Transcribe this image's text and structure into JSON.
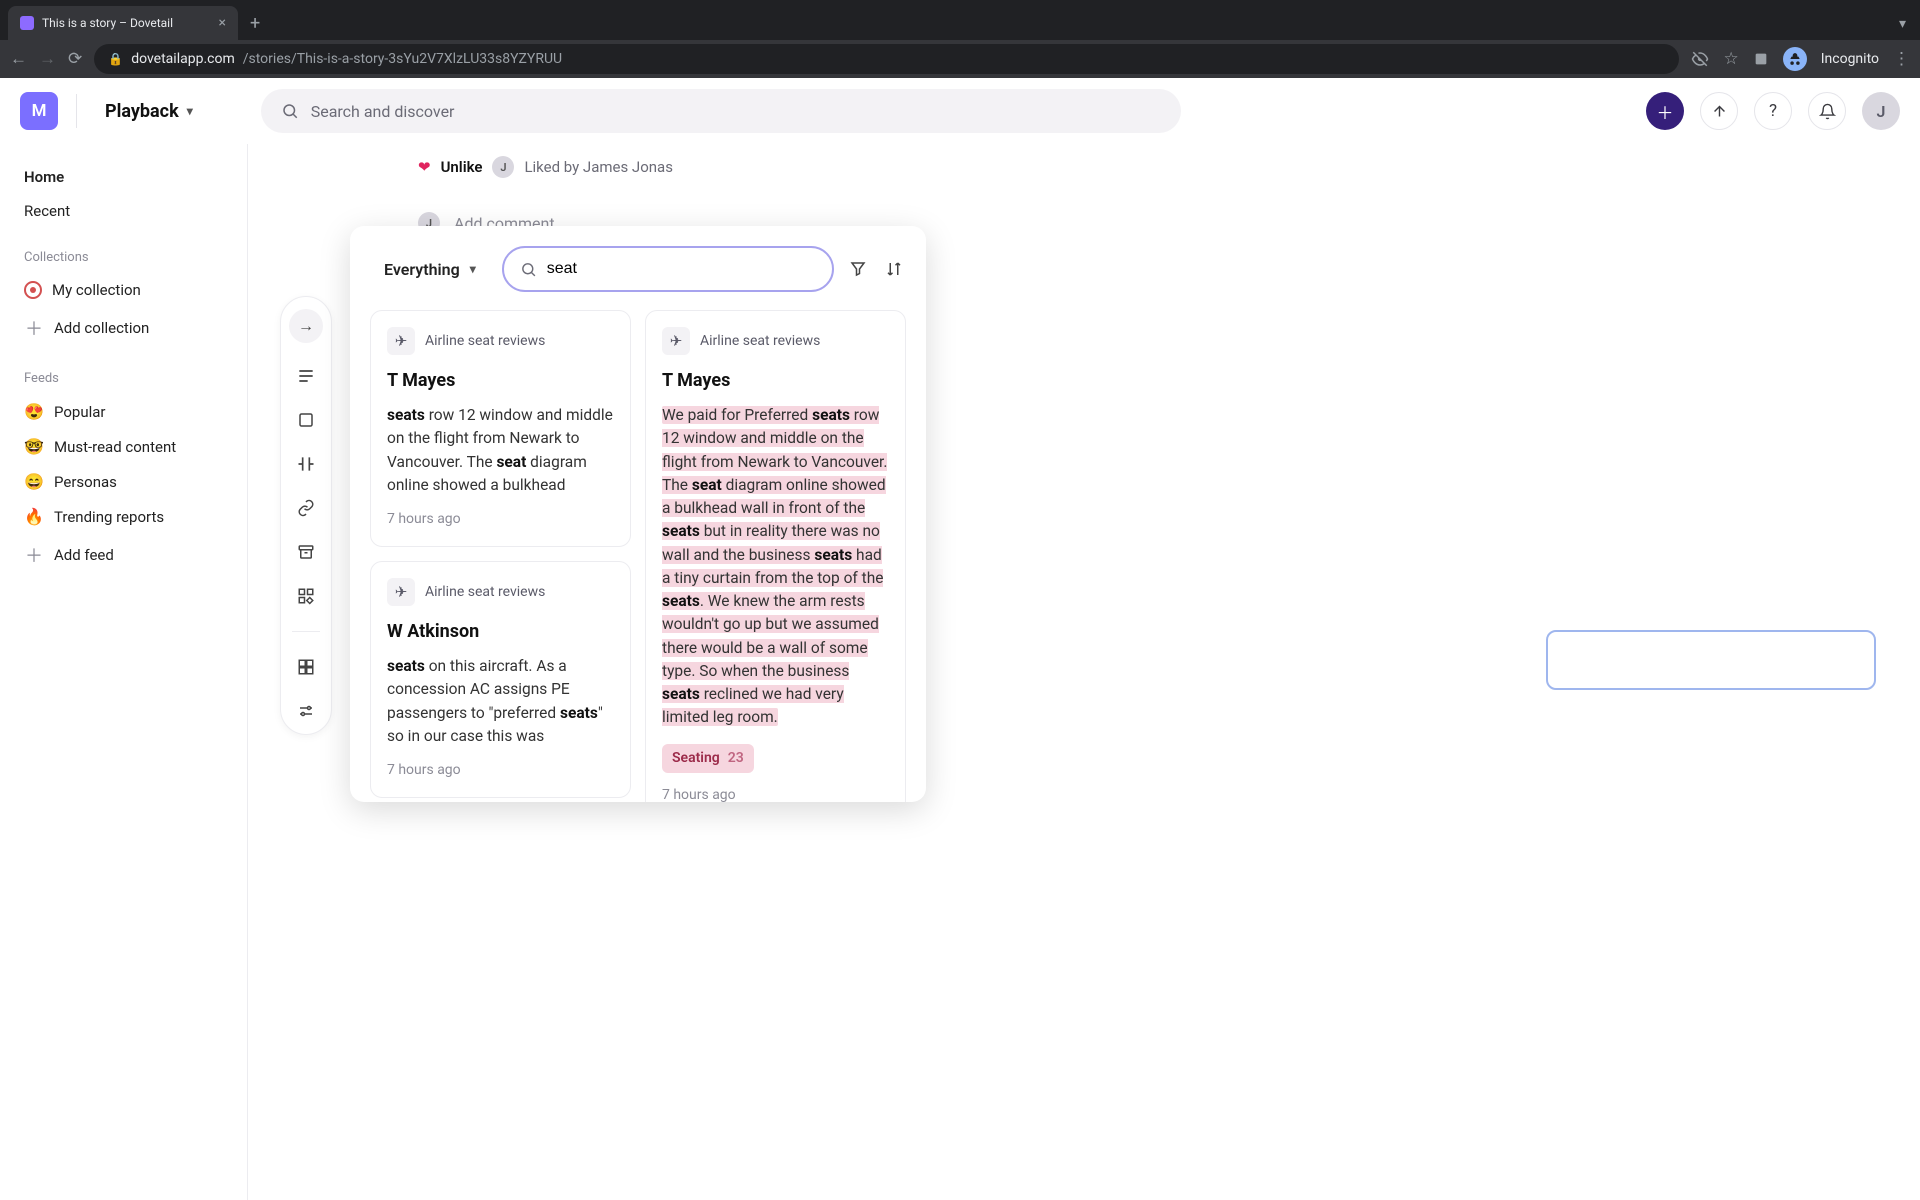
{
  "browser": {
    "tab_title": "This is a story – Dovetail",
    "url_host": "dovetailapp.com",
    "url_path": "/stories/This-is-a-story-3sYu2V7XlzLU33s8YZYRUU",
    "incognito_label": "Incognito"
  },
  "header": {
    "workspace_initial": "M",
    "product_name": "Playback",
    "global_search_placeholder": "Search and discover",
    "user_initial": "J"
  },
  "sidebar": {
    "home": "Home",
    "recent": "Recent",
    "collections_label": "Collections",
    "my_collection": "My collection",
    "add_collection": "Add collection",
    "feeds_label": "Feeds",
    "feeds": [
      {
        "emoji": "😍",
        "label": "Popular"
      },
      {
        "emoji": "🤓",
        "label": "Must-read content"
      },
      {
        "emoji": "😄",
        "label": "Personas"
      },
      {
        "emoji": "🔥",
        "label": "Trending reports"
      }
    ],
    "add_feed": "Add feed"
  },
  "story": {
    "unlike_label": "Unlike",
    "liked_by_text": "Liked by James Jonas",
    "comment_placeholder": "Add comment...",
    "liker_initial": "J"
  },
  "popover": {
    "scope_label": "Everything",
    "search_value": "seat",
    "results_left": [
      {
        "project": "Airline seat reviews",
        "title": "T Mayes",
        "timestamp": "7 hours ago",
        "body_pre": "",
        "kw1": "seats",
        "mid1": " row 12 window and middle on the flight from Newark to Vancouver. The ",
        "kw2": "seat",
        "mid2": " diagram online showed a bulkhead"
      },
      {
        "project": "Airline seat reviews",
        "title": "W Atkinson",
        "timestamp": "7 hours ago",
        "body_pre": "",
        "kw1": "seats",
        "mid1": " on this aircraft. As a concession AC assigns PE passengers to \"preferred ",
        "kw2": "seats",
        "mid2": "\" so in our case this was"
      }
    ],
    "results_right": [
      {
        "project": "Airline seat reviews",
        "title": "T Mayes",
        "timestamp": "7 hours ago",
        "hl_pre": "We paid for Preferred ",
        "kw1": "seats",
        "hl_mid1": " row 12 window and middle on the flight from Newark to Vancouver. The ",
        "kw2": "seat",
        "hl_mid2": " diagram online showed a bulkhead wall in front of the ",
        "kw3": "seats",
        "hl_mid3": " but in reality there was no wall and the business ",
        "kw4": "seats",
        "hl_mid4": " had a tiny curtain from the top of the ",
        "kw5": "seats",
        "hl_mid5": ". We knew the arm rests wouldn't go up but we assumed there would be a wall of some type. So when the business ",
        "kw6": "seats",
        "hl_mid6": " reclined we had very limited leg room.",
        "tag_label": "Seating",
        "tag_count": "23"
      }
    ]
  }
}
